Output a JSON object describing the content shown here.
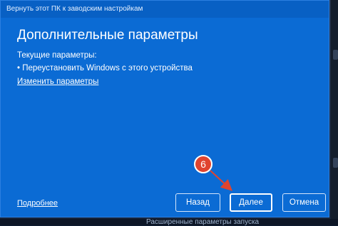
{
  "window": {
    "title": "Вернуть этот ПК к заводским настройкам"
  },
  "dialog": {
    "heading": "Дополнительные параметры",
    "current_settings_label": "Текущие параметры:",
    "settings": [
      "• Переустановить Windows с этого устройства"
    ],
    "change_link": "Изменить параметры",
    "more_link": "Подробнее"
  },
  "buttons": {
    "back": "Назад",
    "next": "Далее",
    "cancel": "Отмена"
  },
  "annotation": {
    "step_number": "6",
    "color": "#e0442f"
  },
  "background": {
    "partial_text": "Расширенные параметры запуска"
  },
  "colors": {
    "dialog_bg": "#0b6bd4",
    "titlebar_bg": "#0860c4"
  }
}
